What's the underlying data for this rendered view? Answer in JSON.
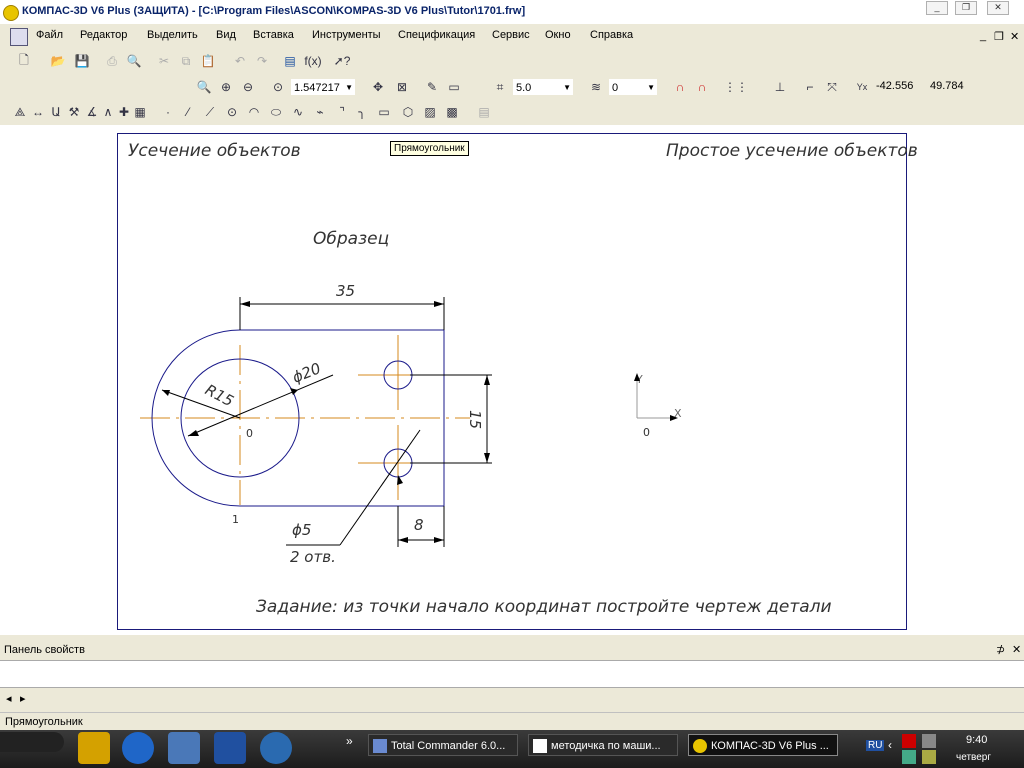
{
  "window": {
    "title": "КОМПАС-3D V6 Plus (ЗАЩИТА) - [C:\\Program Files\\ASCON\\KOMPAS-3D V6 Plus\\Tutor\\1701.frw]",
    "minimize": "_",
    "maximize": "❐",
    "close": "✕"
  },
  "menu": [
    "Файл",
    "Редактор",
    "Выделить",
    "Вид",
    "Вставка",
    "Инструменты",
    "Спецификация",
    "Сервис",
    "Окно",
    "Справка"
  ],
  "toolbar": {
    "zoom_value": "1.547217",
    "step_value": "5.0",
    "layer_value": "0",
    "coord_x": "-42.556",
    "coord_y": "49.784",
    "fx_label": "f(x)"
  },
  "tooltip": "Прямоугольник",
  "drawing": {
    "header_left": "Усечение объектов",
    "header_right": "Простое усечение объектов",
    "sample_label": "Образец",
    "dim_35": "35",
    "dim_phi20": "ϕ20",
    "dim_r15": "R15",
    "dim_15": "15",
    "dim_8": "8",
    "dim_phi5": "ϕ5",
    "holes_note": "2 отв.",
    "origin_label": "0",
    "point_label": "1",
    "axis_y": "Y",
    "axis_x": "X",
    "axis_origin": "0",
    "task_text": "Задание: из точки начало координат постройте чертеж детали"
  },
  "panel": {
    "title": "Панель свойств",
    "pin": "⊅",
    "close": "✕",
    "nav_left": "◂",
    "nav_right": "▸"
  },
  "status": "Прямоугольник",
  "taskbar": {
    "tasks": [
      "Total Commander 6.0...",
      "методичка по маши...",
      "КОМПАС-3D V6 Plus ..."
    ],
    "lang": "RU",
    "time": "9:40",
    "day": "четверг",
    "chevron": "»"
  },
  "colors": {
    "title_text": "#0a246a",
    "drawing_line": "#1a1a8a",
    "axis_line": "#d58a1e",
    "sheet_border": "#1a1a7a"
  }
}
